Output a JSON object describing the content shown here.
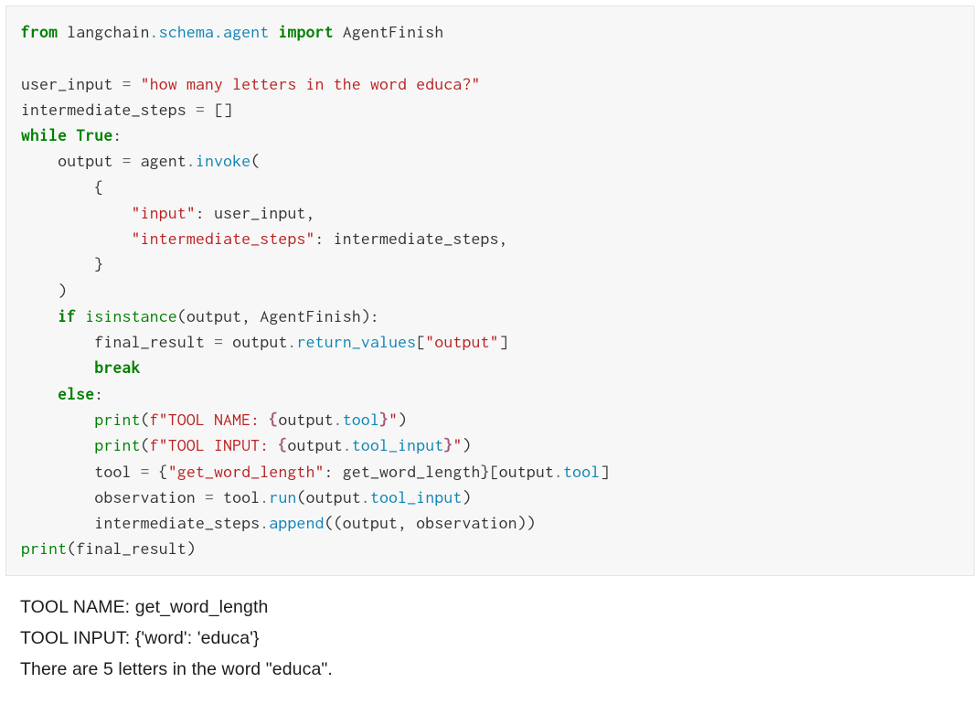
{
  "code": {
    "from_kw": "from",
    "langchain": "langchain",
    "dot1": ".",
    "schema": "schema",
    "dot2": ".",
    "agent_mod": "agent",
    "import_kw": "import",
    "AgentFinish": "AgentFinish",
    "user_input_var": "user_input",
    "eq1": "=",
    "user_input_str": "\"how many letters in the word educa?\"",
    "intermediate_steps_var": "intermediate_steps",
    "eq2": "=",
    "empty_list": "[]",
    "while_kw": "while",
    "true_kc": "True",
    "colon1": ":",
    "output_var": "output",
    "eq3": "=",
    "agent_var": "agent",
    "dot3": ".",
    "invoke": "invoke",
    "lparen1": "(",
    "lbrace1": "{",
    "input_key": "\"input\"",
    "colon2": ":",
    "user_input_ref": "user_input",
    "comma1": ",",
    "inter_key": "\"intermediate_steps\"",
    "colon3": ":",
    "inter_ref": "intermediate_steps",
    "comma2": ",",
    "rbrace1": "}",
    "rparen1": ")",
    "if_kw": "if",
    "isinstance_nb": "isinstance",
    "lparen2": "(",
    "output_ref1": "output",
    "comma3": ",",
    "AgentFinish_ref": "AgentFinish",
    "rparen2": ")",
    "colon4": ":",
    "final_result_var": "final_result",
    "eq4": "=",
    "output_ref2": "output",
    "dot4": ".",
    "return_values": "return_values",
    "output_key": "[\"output\"]",
    "break_kw": "break",
    "else_kw": "else",
    "colon5": ":",
    "print1": "print",
    "lparen3": "(",
    "f1": "f\"TOOL NAME: ",
    "si1_open": "{",
    "output_ref3": "output",
    "dot5": ".",
    "tool_attr1": "tool",
    "si1_close": "}",
    "f1_end": "\"",
    "rparen3": ")",
    "print2": "print",
    "lparen4": "(",
    "f2": "f\"TOOL INPUT: ",
    "si2_open": "{",
    "output_ref4": "output",
    "dot6": ".",
    "tool_input_attr": "tool_input",
    "si2_close": "}",
    "f2_end": "\"",
    "rparen4": ")",
    "tool_var": "tool",
    "eq5": "=",
    "lbrace2": "{",
    "gwl_key": "\"get_word_length\"",
    "colon6": ":",
    "gwl_ref": "get_word_length",
    "rbrace2": "}",
    "lbracket1": "[",
    "output_ref5": "output",
    "dot7": ".",
    "tool_attr2": "tool",
    "rbracket1": "]",
    "observation_var": "observation",
    "eq6": "=",
    "tool_ref": "tool",
    "dot8": ".",
    "run": "run",
    "lparen5": "(",
    "output_ref6": "output",
    "dot9": ".",
    "tool_input_attr2": "tool_input",
    "rparen5": ")",
    "inter_ref2": "intermediate_steps",
    "dot10": ".",
    "append": "append",
    "lparen6": "((",
    "output_ref7": "output",
    "comma4": ",",
    "observation_ref": "observation",
    "rparen6": "))",
    "print3": "print",
    "lparen7": "(",
    "final_result_ref": "final_result",
    "rparen7": ")"
  },
  "output": {
    "line1": "TOOL NAME: get_word_length",
    "line2": "TOOL INPUT: {'word': 'educa'}",
    "line3": "There are 5 letters in the word \"educa\"."
  }
}
